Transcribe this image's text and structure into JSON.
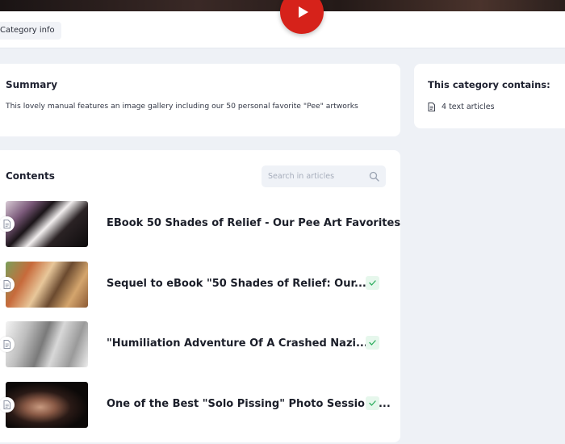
{
  "tab": {
    "label": "Category info"
  },
  "summary": {
    "title": "Summary",
    "text": "This lovely manual features an image gallery including our 50 personal favorite \"Pee\" artworks"
  },
  "contains": {
    "title": "This category contains:",
    "item": "4 text articles"
  },
  "contents": {
    "title": "Contents",
    "search_placeholder": "Search in articles",
    "articles": [
      {
        "title": "EBook 50 Shades of Relief - Our Pee Art Favorites",
        "checked": false
      },
      {
        "title": "Sequel to eBook \"50 Shades of Relief: Our...",
        "checked": true
      },
      {
        "title": "\"Humiliation Adventure Of A Crashed Nazi...",
        "checked": true
      },
      {
        "title": "One of the Best \"Solo Pissing\" Photo Sessions...",
        "checked": true
      }
    ]
  },
  "colors": {
    "play": "#d6221a",
    "check": "#2fae5f",
    "background": "#eef1f6"
  },
  "icons": [
    "play-icon",
    "document-icon",
    "search-icon",
    "check-icon"
  ]
}
